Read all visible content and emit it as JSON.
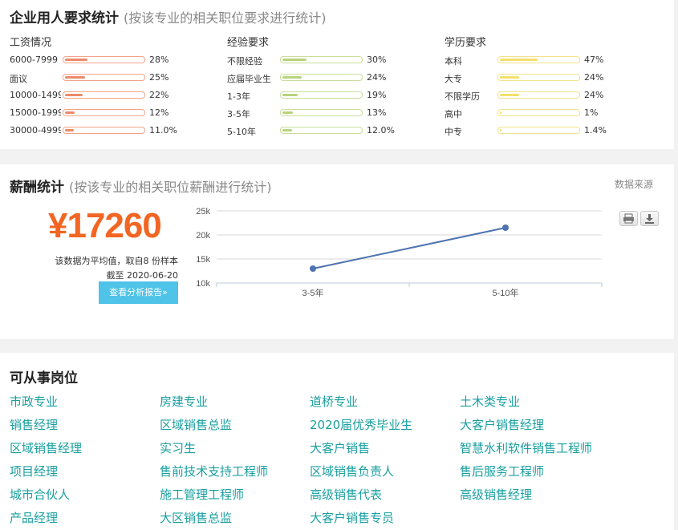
{
  "requirements": {
    "title": "企业用人要求统计",
    "subtitle": "(按该专业的相关职位要求进行统计)",
    "columns": [
      {
        "title": "工资情况",
        "bar_color": "#f4a48a",
        "fill_color": "#ee8a69",
        "rows": [
          {
            "label": "6000-7999",
            "pct": "28%",
            "value": 0.28
          },
          {
            "label": "面议",
            "pct": "25%",
            "value": 0.25
          },
          {
            "label": "10000-1499",
            "pct": "22%",
            "value": 0.22
          },
          {
            "label": "15000-1999",
            "pct": "12%",
            "value": 0.12
          },
          {
            "label": "30000-4999",
            "pct": "11.0%",
            "value": 0.11
          }
        ]
      },
      {
        "title": "经验要求",
        "bar_color": "#c9de9b",
        "fill_color": "#b7d47a",
        "rows": [
          {
            "label": "不限经验",
            "pct": "30%",
            "value": 0.3
          },
          {
            "label": "应届毕业生",
            "pct": "24%",
            "value": 0.24
          },
          {
            "label": "1-3年",
            "pct": "19%",
            "value": 0.19
          },
          {
            "label": "3-5年",
            "pct": "13%",
            "value": 0.13
          },
          {
            "label": "5-10年",
            "pct": "12.0%",
            "value": 0.12
          }
        ]
      },
      {
        "title": "学历要求",
        "bar_color": "#f3e38a",
        "fill_color": "#f5e06a",
        "rows": [
          {
            "label": "本科",
            "pct": "47%",
            "value": 0.47
          },
          {
            "label": "大专",
            "pct": "24%",
            "value": 0.24
          },
          {
            "label": "不限学历",
            "pct": "24%",
            "value": 0.24
          },
          {
            "label": "高中",
            "pct": "1%",
            "value": 0.01
          },
          {
            "label": "中专",
            "pct": "1.4%",
            "value": 0.014
          }
        ]
      }
    ]
  },
  "salary": {
    "title": "薪酬统计",
    "subtitle": "(按该专业的相关职位薪酬进行统计)",
    "source_link": "数据来源",
    "amount": "¥17260",
    "note_line1": "该数据为平均值，取自8 份样本",
    "note_line2": "截至 2020-06-20",
    "report_button": "查看分析报告»",
    "accent_color": "#f26522",
    "icons": [
      "print-icon",
      "download-icon"
    ]
  },
  "chart_data": {
    "type": "line",
    "categories": [
      "3-5年",
      "5-10年"
    ],
    "series": [
      {
        "values": [
          13000,
          21500
        ]
      }
    ],
    "y_ticks": [
      "10k",
      "15k",
      "20k",
      "25k"
    ],
    "ylim": [
      10000,
      25000
    ],
    "grid": true,
    "line_color": "#4e73b0"
  },
  "positions": {
    "title": "可从事岗位",
    "items": [
      "市政专业",
      "房建专业",
      "道桥专业",
      "土木类专业",
      "销售经理",
      "区域销售总监",
      "2020届优秀毕业生",
      "大客户销售经理",
      "区域销售经理",
      "实习生",
      "大客户销售",
      "智慧水利软件销售工程师",
      "项目经理",
      "售前技术支持工程师",
      "区域销售负责人",
      "售后服务工程师",
      "城市合伙人",
      "施工管理工程师",
      "高级销售代表",
      "高级销售经理",
      "产品经理",
      "大区销售总监",
      "大客户销售专员"
    ]
  }
}
